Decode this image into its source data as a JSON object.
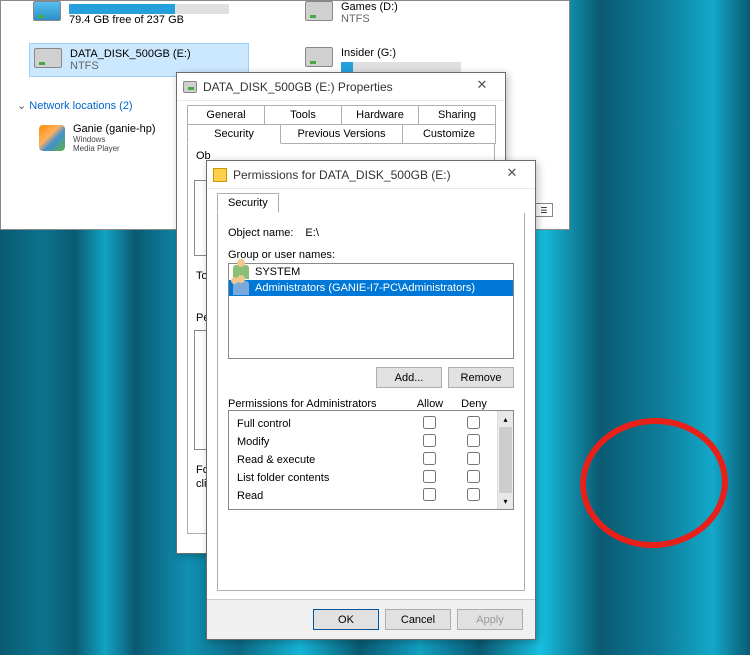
{
  "explorer": {
    "drives": [
      {
        "name": "",
        "sub": "79.4 GB free of 237 GB",
        "fill": 66,
        "sel": false
      },
      {
        "name": "DATA_DISK_500GB (E:)",
        "sub": "NTFS",
        "fill": 0,
        "sel": true
      },
      {
        "name": "Games (D:)",
        "sub": "NTFS",
        "fill": 0,
        "sel": false
      },
      {
        "name": "Insider (G:)",
        "sub": "",
        "fill": 0,
        "sel": false
      }
    ],
    "network_heading": "Network locations (2)",
    "wmp_label": "Ganie (ganie-hp)",
    "wmp_caption": "Windows Media Player"
  },
  "properties": {
    "title": "DATA_DISK_500GB (E:) Properties",
    "tabs_row1": [
      "General",
      "Tools",
      "Hardware",
      "Sharing"
    ],
    "tabs_row2": [
      "Security",
      "Previous Versions",
      "Customize"
    ],
    "active_tab": "Security",
    "partial": {
      "ob": "Ob",
      "to": "To",
      "pe": "Pe",
      "fo": "Fo",
      "cli": "clic"
    }
  },
  "permissions": {
    "title": "Permissions for DATA_DISK_500GB (E:)",
    "tab": "Security",
    "object_label": "Object name:",
    "object_value": "E:\\",
    "group_label": "Group or user names:",
    "users": [
      {
        "name": "SYSTEM",
        "sel": false,
        "multi": false
      },
      {
        "name": "Administrators (GANIE-I7-PC\\Administrators)",
        "sel": true,
        "multi": true
      }
    ],
    "add_label": "Add...",
    "remove_label": "Remove",
    "perm_for_label": "Permissions for Administrators",
    "col_allow": "Allow",
    "col_deny": "Deny",
    "perm_rows": [
      "Full control",
      "Modify",
      "Read & execute",
      "List folder contents",
      "Read"
    ],
    "ok": "OK",
    "cancel": "Cancel",
    "apply": "Apply"
  }
}
